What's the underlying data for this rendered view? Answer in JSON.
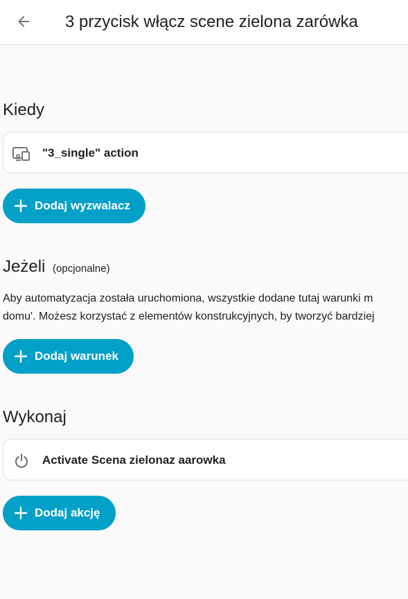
{
  "header": {
    "title": "3 przycisk włącz scene zielona zarówka",
    "back_icon": "arrow-left-icon"
  },
  "triggers": {
    "heading": "Kiedy",
    "items": [
      {
        "label": "\"3_single\" action",
        "icon": "device-icon"
      }
    ],
    "add_label": "Dodaj wyzwalacz"
  },
  "conditions": {
    "heading": "Jeżeli",
    "optional": "(opcjonalne)",
    "description_line1": "Aby automatyzacja została uruchomiona, wszystkie dodane tutaj warunki m",
    "description_line2": "domu'. Możesz korzystać z elementów konstrukcyjnych, by tworzyć bardziej",
    "add_label": "Dodaj warunek"
  },
  "actions": {
    "heading": "Wykonaj",
    "items": [
      {
        "label": "Activate Scena zielonaz aarowka",
        "icon": "power-icon"
      }
    ],
    "add_label": "Dodaj akcję"
  },
  "colors": {
    "accent": "#03a0c8",
    "background": "#fafafa",
    "card": "#ffffff"
  }
}
